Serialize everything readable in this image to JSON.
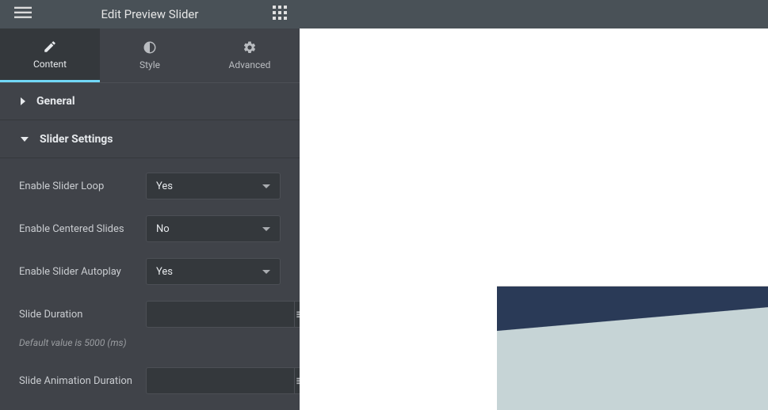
{
  "header": {
    "title": "Edit Preview Slider"
  },
  "tabs": {
    "content": "Content",
    "style": "Style",
    "advanced": "Advanced"
  },
  "sections": {
    "general": "General",
    "slider_settings": "Slider Settings"
  },
  "settings": {
    "loop": {
      "label": "Enable Slider Loop",
      "value": "Yes"
    },
    "centered": {
      "label": "Enable Centered Slides",
      "value": "No"
    },
    "autoplay": {
      "label": "Enable Slider Autoplay",
      "value": "Yes"
    },
    "duration": {
      "label": "Slide Duration",
      "value": "",
      "hint": "Default value is 5000 (ms)"
    },
    "anim_duration": {
      "label": "Slide Animation Duration",
      "value": ""
    }
  }
}
